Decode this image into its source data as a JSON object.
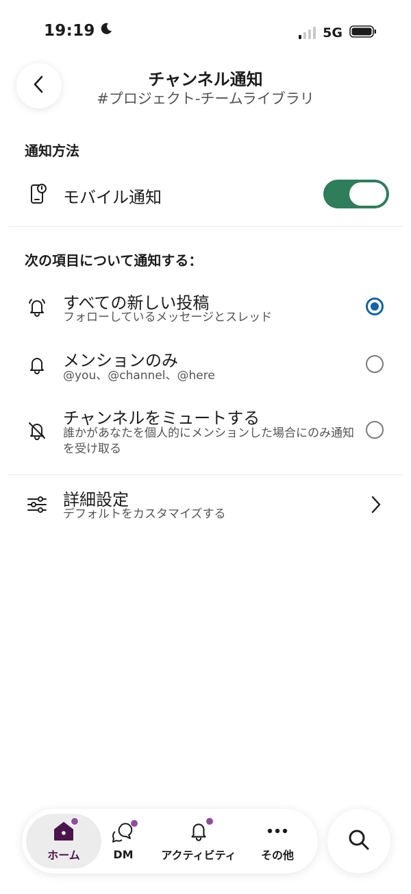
{
  "status_bar": {
    "time": "19:19",
    "network": "5G",
    "icons": [
      "moon-icon",
      "signal-icon",
      "battery-icon"
    ]
  },
  "header": {
    "title": "チャンネル通知",
    "subtitle": "#プロジェクト-チームライブラリ",
    "back_icon": "chevron-left-icon"
  },
  "method_section": {
    "heading": "通知方法",
    "mobile": {
      "label": "モバイル通知",
      "icon": "mobile-notification-icon",
      "enabled": true
    }
  },
  "notify_section": {
    "heading": "次の項目について通知する：",
    "options": [
      {
        "title": "すべての新しい投稿",
        "subtitle": "フォローしているメッセージとスレッド",
        "icon": "bell-ringing-icon",
        "selected": true
      },
      {
        "title": "メンションのみ",
        "subtitle": "@you、@channel、@here",
        "icon": "bell-icon",
        "selected": false
      },
      {
        "title": "チャンネルをミュートする",
        "subtitle": "誰かがあなたを個人的にメンションした場合にのみ通知を受け取る",
        "icon": "bell-off-icon",
        "selected": false
      }
    ]
  },
  "advanced": {
    "title": "詳細設定",
    "subtitle": "デフォルトをカスタマイズする",
    "icon": "sliders-icon",
    "chevron": "chevron-right-icon"
  },
  "bottom_nav": {
    "items": [
      {
        "label": "ホーム",
        "icon": "home-icon",
        "active": true,
        "badge": true
      },
      {
        "label": "DM",
        "icon": "dm-icon",
        "active": false,
        "badge": true
      },
      {
        "label": "アクティビティ",
        "icon": "bell-icon",
        "active": false,
        "badge": true
      },
      {
        "label": "その他",
        "icon": "more-icon",
        "active": false,
        "badge": false
      }
    ],
    "search_icon": "search-icon"
  },
  "colors": {
    "toggle_on": "#2e7d5b",
    "radio_selected": "#1264a3",
    "brand_purple": "#4a154b",
    "badge": "#8e4e9a"
  }
}
